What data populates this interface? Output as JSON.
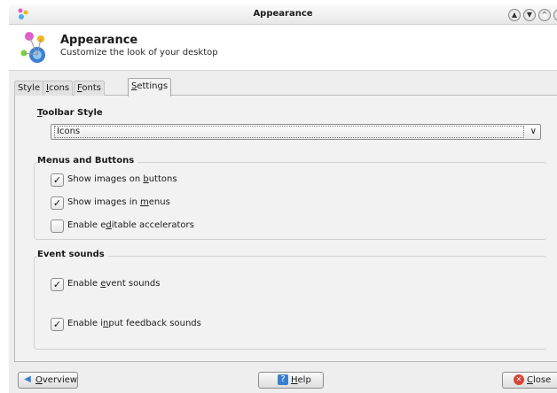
{
  "window": {
    "title": "Appearance",
    "controls": [
      "minimize",
      "maximize",
      "restore"
    ]
  },
  "header": {
    "title": "Appearance",
    "subtitle": "Customize the look of your desktop"
  },
  "tabs": [
    {
      "pre": "",
      "key": "",
      "post": "Style"
    },
    {
      "pre": "",
      "key": "I",
      "post": "cons"
    },
    {
      "pre": "",
      "key": "F",
      "post": "onts"
    },
    {
      "pre": "",
      "key": "S",
      "post": "ettings"
    }
  ],
  "active_tab": "Settings",
  "toolbar_style": {
    "title_key": "T",
    "title_rest": "oolbar Style",
    "selected": "Icons"
  },
  "menus_buttons": {
    "title": "Menus and Buttons",
    "options": [
      {
        "pre": "Show images on ",
        "key": "b",
        "post": "uttons",
        "checked": true,
        "mark": "✓"
      },
      {
        "pre": "Show images in ",
        "key": "m",
        "post": "enus",
        "checked": true,
        "mark": "✓"
      },
      {
        "pre": "Enable e",
        "key": "d",
        "post": "itable accelerators",
        "checked": false,
        "mark": ""
      }
    ]
  },
  "event_sounds": {
    "title": "Event sounds",
    "options": [
      {
        "pre": "Enable ",
        "key": "e",
        "post": "vent sounds",
        "checked": true,
        "mark": "✓"
      },
      {
        "pre": "Enable i",
        "key": "n",
        "post": "put feedback sounds",
        "checked": true,
        "mark": "✓"
      }
    ]
  },
  "buttons": {
    "overview": {
      "key": "O",
      "rest": "verview"
    },
    "help": {
      "key": "H",
      "rest": "elp"
    },
    "close": {
      "key": "C",
      "rest": "lose"
    }
  },
  "colors": {
    "accent_blue": "#3c7fd0",
    "close_red": "#d9443a"
  },
  "icons": {
    "app": "appearance-palette-icon",
    "overview": "back-arrow-icon",
    "help": "help-book-icon",
    "close": "close-circle-icon"
  }
}
